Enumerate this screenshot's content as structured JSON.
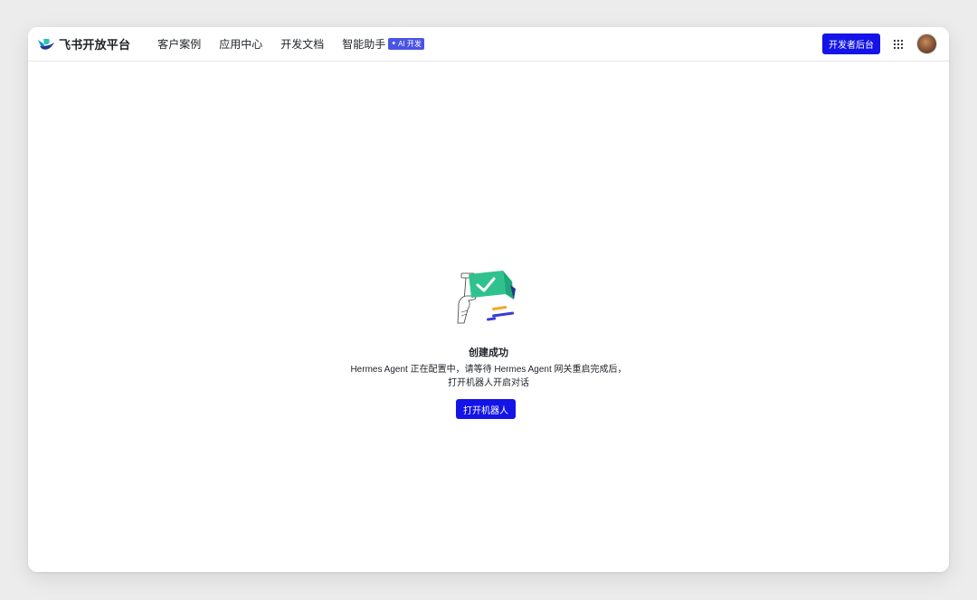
{
  "brand": {
    "name": "飞书开放平台",
    "logo_icon": "feishu-logo-icon"
  },
  "nav": {
    "items": [
      {
        "label": "客户案例"
      },
      {
        "label": "应用中心"
      },
      {
        "label": "开发文档"
      },
      {
        "label": "智能助手",
        "badge": "AI 开发"
      }
    ]
  },
  "header_right": {
    "dev_console_label": "开发者后台",
    "apps_icon": "grid-icon",
    "avatar_icon": "user-avatar"
  },
  "result": {
    "illustration_icon": "success-flag-illustration",
    "title": "创建成功",
    "desc_line1": "Hermes Agent 正在配置中，请等待 Hermes Agent 网关重启完成后，",
    "desc_line2": "打开机器人开启对话",
    "button_label": "打开机器人"
  },
  "colors": {
    "primary": "#1414e8",
    "ai_badge": "#4954e6",
    "success_green": "#2fc28f",
    "text": "#1f2329",
    "accent_yellow": "#f5a623"
  }
}
